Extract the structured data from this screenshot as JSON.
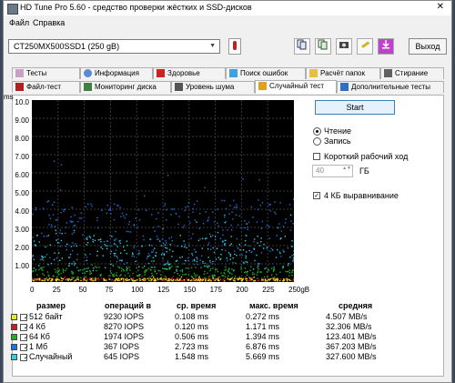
{
  "window": {
    "title": "HD Tune Pro 5.60 - средство проверки жёстких и SSD-дисков",
    "close_glyph": "✕"
  },
  "menu": {
    "file": "Файл",
    "help": "Справка"
  },
  "toolbar": {
    "drive": "CT250MX500SSD1 (250 gB)",
    "dropdown_glyph": "▼",
    "exit": "Выход",
    "icons": [
      "copy-icon",
      "copy-text-icon",
      "camera-icon",
      "wrench-icon",
      "download-icon"
    ]
  },
  "tabs_row1": [
    {
      "label": "Тесты",
      "icon": "tests-icon",
      "color": "#c8a0c8"
    },
    {
      "label": "Информация",
      "icon": "info-icon",
      "color": "#5a8ad0"
    },
    {
      "label": "Здоровье",
      "icon": "health-icon",
      "color": "#d02020"
    },
    {
      "label": "Поиск ошибок",
      "icon": "scan-icon",
      "color": "#40a0e0"
    },
    {
      "label": "Расчёт папок",
      "icon": "folder-icon",
      "color": "#e8c040"
    },
    {
      "label": "Стирание",
      "icon": "erase-icon",
      "color": "#606060"
    }
  ],
  "tabs_row2": [
    {
      "label": "Файл-тест",
      "icon": "file-test-icon",
      "color": "#b02020"
    },
    {
      "label": "Мониторинг диска",
      "icon": "monitor-icon",
      "color": "#408040"
    },
    {
      "label": "Уровень шума",
      "icon": "speaker-icon",
      "color": "#555555"
    },
    {
      "label": "Случайный тест",
      "icon": "random-test-icon",
      "color": "#e0a020"
    },
    {
      "label": "Дополнительные тесты",
      "icon": "extra-tests-icon",
      "color": "#3070c0"
    }
  ],
  "chart_data": {
    "type": "scatter",
    "ylabel": "ms",
    "xlabel": "",
    "yticks": [
      "10.0",
      "9.00",
      "8.00",
      "7.00",
      "6.00",
      "5.00",
      "4.00",
      "3.00",
      "2.00",
      "1.00"
    ],
    "xticks": [
      "0",
      "25",
      "50",
      "75",
      "100",
      "125",
      "150",
      "175",
      "200",
      "225",
      "250gB"
    ],
    "ylim": [
      0,
      10
    ],
    "xlim": [
      0,
      250
    ],
    "grid": true,
    "series": [
      {
        "name": "512 байт",
        "color": "#e8e820",
        "typical_ms": 0.108
      },
      {
        "name": "4 Кб",
        "color": "#c81e1e",
        "typical_ms": 0.12
      },
      {
        "name": "64 Кб",
        "color": "#20b020",
        "typical_ms": 0.506
      },
      {
        "name": "1 Мб",
        "color": "#2070e0",
        "typical_ms": 2.723
      },
      {
        "name": "Случайный",
        "color": "#30d0e0",
        "typical_ms": 1.548
      }
    ]
  },
  "controls": {
    "start": "Start",
    "read": "Чтение",
    "write": "Запись",
    "short_stroke": "Короткий рабочий ход",
    "short_value": "40",
    "short_unit": "ГБ",
    "align": "4 КБ выравнивание",
    "spin_glyph": "▲▼",
    "check_glyph": "✓"
  },
  "table": {
    "headers": [
      "размер",
      "операций в",
      "ср. время",
      "макс. время",
      "средняя"
    ],
    "rows": [
      {
        "color": "#e8e820",
        "size": "512 байт",
        "ops": "9230 IOPS",
        "avg": "0.108 ms",
        "max": "0.272 ms",
        "rate": "4.507 MB/s"
      },
      {
        "color": "#c81e1e",
        "size": "4 Кб",
        "ops": "8270 IOPS",
        "avg": "0.120 ms",
        "max": "1.171 ms",
        "rate": "32.306 MB/s"
      },
      {
        "color": "#20b020",
        "size": "64 Кб",
        "ops": "1974 IOPS",
        "avg": "0.506 ms",
        "max": "1.394 ms",
        "rate": "123.401 MB/s"
      },
      {
        "color": "#2070e0",
        "size": "1 Мб",
        "ops": "367 IOPS",
        "avg": "2.723 ms",
        "max": "6.876 ms",
        "rate": "367.203 MB/s"
      },
      {
        "color": "#30d0e0",
        "size": "Случайный",
        "ops": "645 IOPS",
        "avg": "1.548 ms",
        "max": "5.669 ms",
        "rate": "327.600 MB/s"
      }
    ]
  }
}
